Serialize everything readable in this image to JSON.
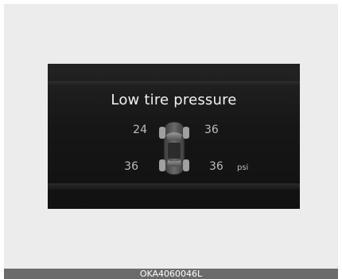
{
  "display": {
    "title": "Low tire pressure",
    "status_color": "#f0a020",
    "tires": {
      "front_left": {
        "value": "24",
        "low": true
      },
      "front_right": {
        "value": "36",
        "low": false
      },
      "rear_left": {
        "value": "36",
        "low": false
      },
      "rear_right": {
        "value": "36",
        "low": false
      }
    },
    "unit": "psi",
    "icon": "car-top-view-icon"
  },
  "footer": {
    "code": "OKA4060046L"
  }
}
